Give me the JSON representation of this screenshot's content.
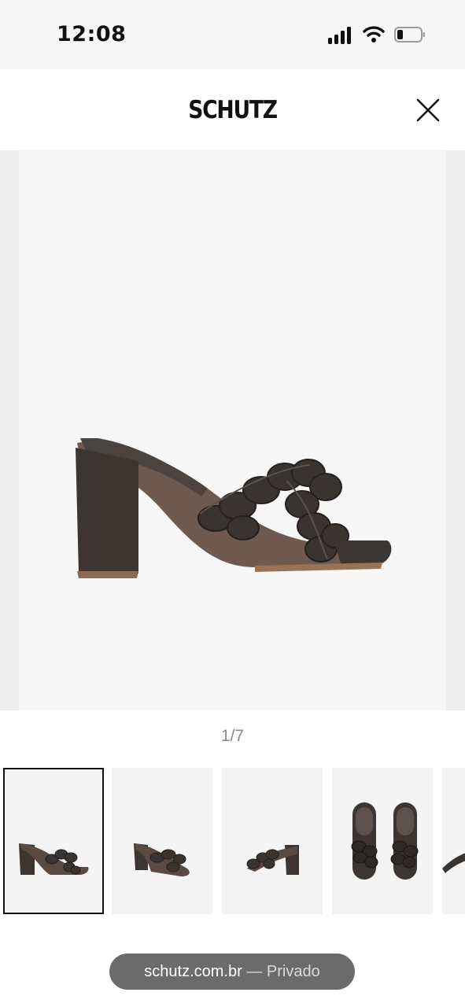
{
  "status_bar": {
    "time": "12:08"
  },
  "header": {
    "brand": "SCHUTZ"
  },
  "gallery": {
    "counter": "1/7"
  },
  "url_bar": {
    "domain": "schutz.com.br",
    "separator": " — ",
    "mode": "Privado"
  },
  "icons": [
    "signal-icon",
    "wifi-icon",
    "battery-icon",
    "close-icon"
  ],
  "colors": {
    "shoe": "#3d3532",
    "sole": "#7a5a42",
    "image_bg": "#f7f7f7"
  }
}
